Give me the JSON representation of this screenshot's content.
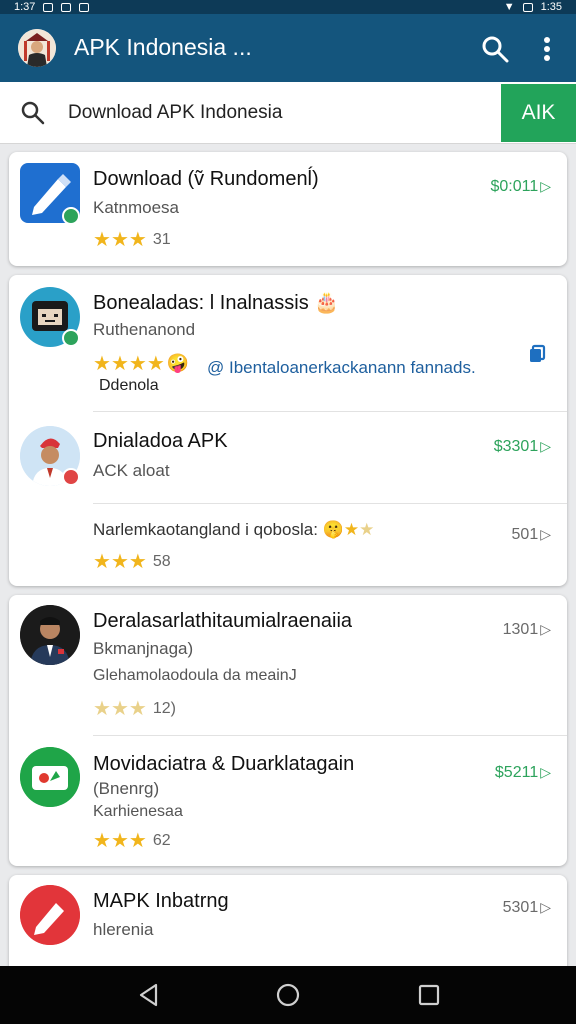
{
  "status_bar": {
    "time": "1:35",
    "left_text": "1:37"
  },
  "app_bar": {
    "title": "APK Indonesia ...",
    "avatar_icon": "avatar-icon",
    "search_icon": "search-icon",
    "more_icon": "more-vertical-icon"
  },
  "search": {
    "value": "Download APK Indonesia",
    "button_label": "AIK"
  },
  "colors": {
    "app_bar": "#14557d",
    "status_bar": "#0d3a57",
    "accent_green": "#22a45a",
    "price_green": "#2da35c",
    "star": "#f1b51c",
    "link_blue": "#1e5f9e"
  },
  "cards": [
    {
      "items": [
        {
          "name": "Download (ṽ Rundomenĺ)",
          "sub": "Katnmoesa",
          "rating": 3,
          "rating_text": "31",
          "price": "$0:011",
          "price_style": "green",
          "icon": "pen-icon"
        }
      ]
    },
    {
      "items": [
        {
          "name": "Bonealadas: l Inalnassis",
          "name_emoji": "🎂",
          "sub": "Ruthenanond",
          "rating": 4,
          "rating_emoji": "🤪",
          "note": "@ Ibentaloanerkackanann fannads.",
          "extra": "Ddenola",
          "icon": "face-avatar-icon",
          "action_icon": "copy-icon"
        },
        {
          "name": "Dnialadoa APK",
          "sub": "ACK aloat",
          "price": "$3301",
          "price_style": "green",
          "icon": "person-avatar-icon"
        },
        {
          "name": "Narlemkaotangland i qobosla:",
          "name_emoji": "🤫",
          "rating": 3,
          "rating_text": "58",
          "price": "501",
          "price_style": "gray"
        }
      ]
    },
    {
      "items": [
        {
          "name": "Deralasarlathitaumialraenaiia",
          "sub": "Bkmanjnaga)",
          "extra": "Glehamolaodoula da meainJ",
          "rating": 3,
          "rating_faded": true,
          "rating_text": "12)",
          "price": "1301",
          "price_style": "gray",
          "icon": "man-portrait-icon"
        },
        {
          "name": "Movidaciatra & Duarklatagain",
          "sub": "(Bnenrg)",
          "extra": "Karhienesaa",
          "rating": 3,
          "rating_text": "62",
          "price": "$5211",
          "price_style": "green",
          "icon": "card-icon"
        }
      ]
    },
    {
      "items": [
        {
          "name": "MAPK Inbatrng",
          "sub": "hlerenia",
          "price": "5301",
          "price_style": "gray",
          "icon": "red-pen-icon"
        }
      ]
    }
  ],
  "nav": {
    "back_icon": "back-triangle-icon",
    "home_icon": "home-circle-icon",
    "recents_icon": "recents-square-icon"
  }
}
